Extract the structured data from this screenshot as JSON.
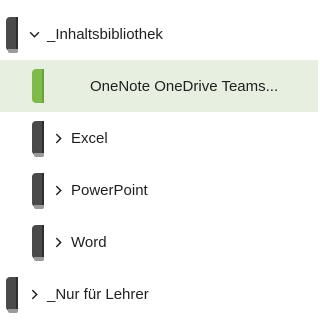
{
  "notebook_tree": {
    "items": [
      {
        "label": "_Inhaltsbibliothek",
        "expanded": true,
        "level": 0,
        "tab_color": "#4a4a4a"
      },
      {
        "label": "OneNote OneDrive Teams...",
        "selected": true,
        "level": 1,
        "tab_color": "#80bb4a"
      },
      {
        "label": "Excel",
        "expanded": false,
        "level": 1,
        "tab_color": "#4a4a4a"
      },
      {
        "label": "PowerPoint",
        "expanded": false,
        "level": 1,
        "tab_color": "#4a4a4a"
      },
      {
        "label": "Word",
        "expanded": false,
        "level": 1,
        "tab_color": "#4a4a4a"
      },
      {
        "label": "_Nur für Lehrer",
        "expanded": false,
        "level": 0,
        "tab_color": "#4a4a4a"
      }
    ]
  },
  "colors": {
    "selected_row_background": "#e7efe0",
    "selected_tab": "#80bb4a",
    "section_tab": "#4a4a4a"
  }
}
